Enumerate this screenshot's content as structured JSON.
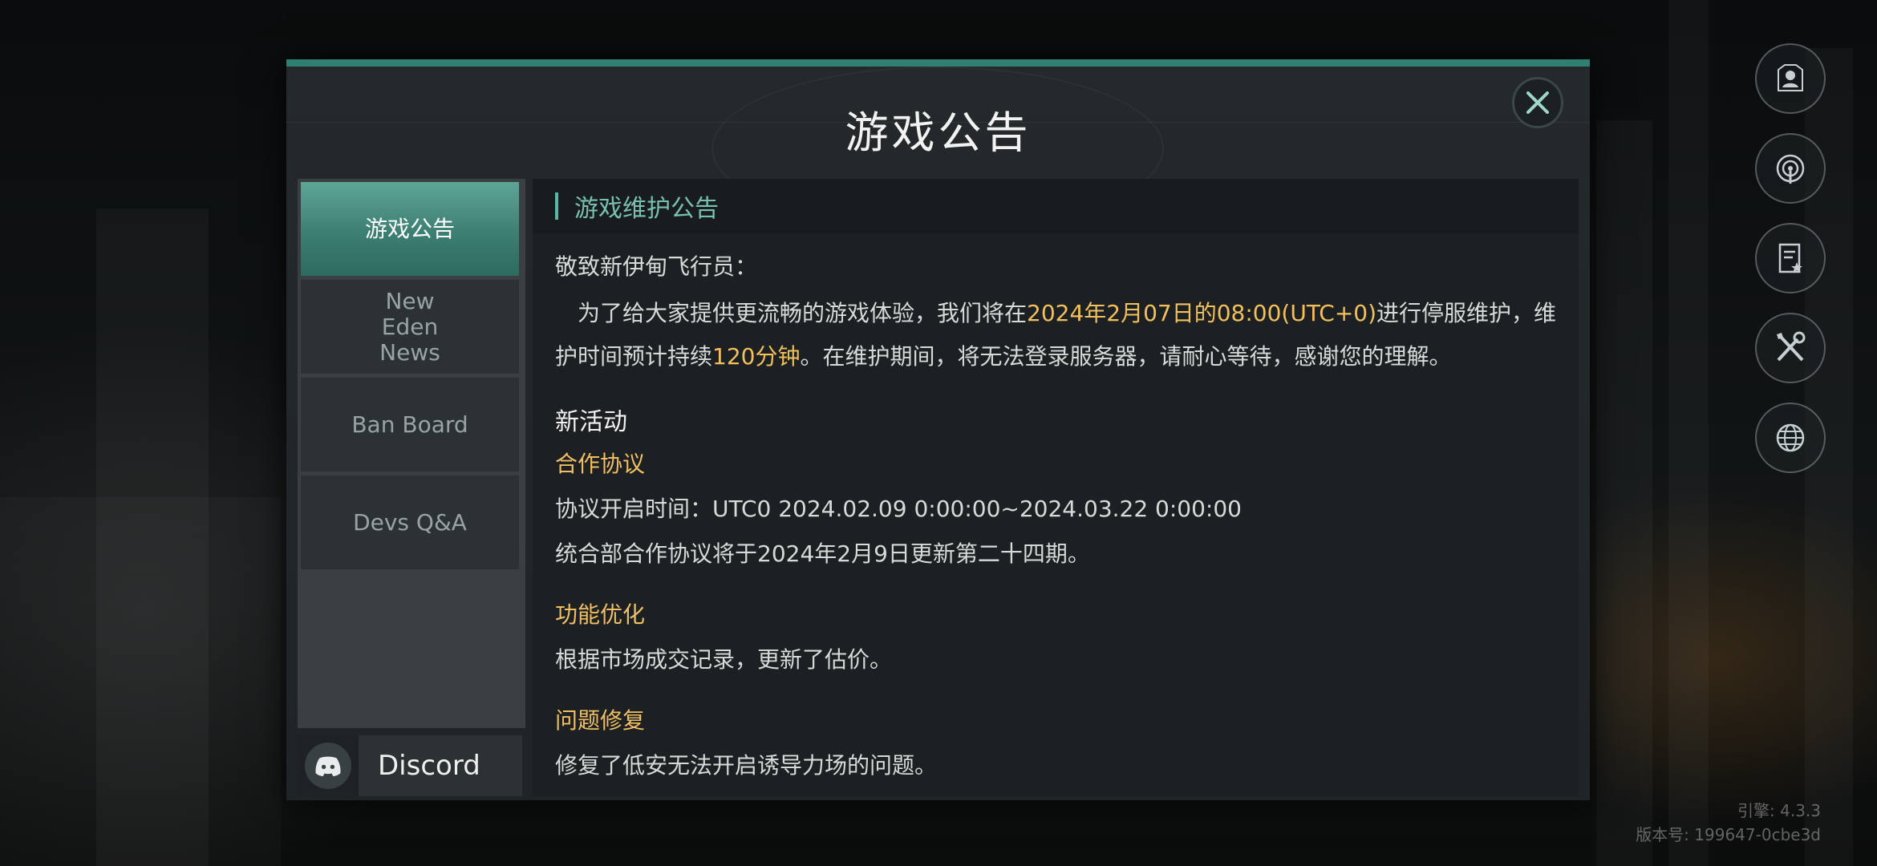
{
  "modal": {
    "title": "游戏公告"
  },
  "sidebar": {
    "tabs": [
      {
        "label": "游戏公告",
        "active": true
      },
      {
        "label": "New Eden News",
        "active": false
      },
      {
        "label": "Ban Board",
        "active": false
      },
      {
        "label": "Devs Q&A",
        "active": false
      }
    ],
    "discord_label": "Discord"
  },
  "content": {
    "header": "游戏维护公告",
    "greeting": "敬致新伊甸飞行员：",
    "para1_a": "为了给大家提供更流畅的游戏体验，我们将在",
    "para1_highlight": "2024年2月07日的08:00(UTC+0)",
    "para1_b": "进行停服维护，维",
    "para2_a": "护时间预计持续",
    "para2_highlight": "120分钟",
    "para2_b": "。在维护期间，将无法登录服务器，请耐心等待，感谢您的理解。",
    "new_activity": "新活动",
    "coop_title": "合作协议",
    "coop_time": "协议开启时间：UTC0 2024.02.09 0:00:00~2024.03.22 0:00:00",
    "coop_desc": "统合部合作协议将于2024年2月9日更新第二十四期。",
    "feature_title": "功能优化",
    "feature_desc": "根据市场成交记录，更新了估价。",
    "fix_title": "问题修复",
    "fix_desc": "修复了低安无法开启诱导力场的问题。"
  },
  "side_icons": [
    "profile-icon",
    "signal-icon",
    "document-star-icon",
    "tools-icon",
    "globe-icon"
  ],
  "build": {
    "engine": "引擎: 4.3.3",
    "version": "版本号: 199647-0cbe3d"
  },
  "colors": {
    "accent": "#2f7f72",
    "highlight": "#f3c05e",
    "header_text": "#78c0b1"
  }
}
